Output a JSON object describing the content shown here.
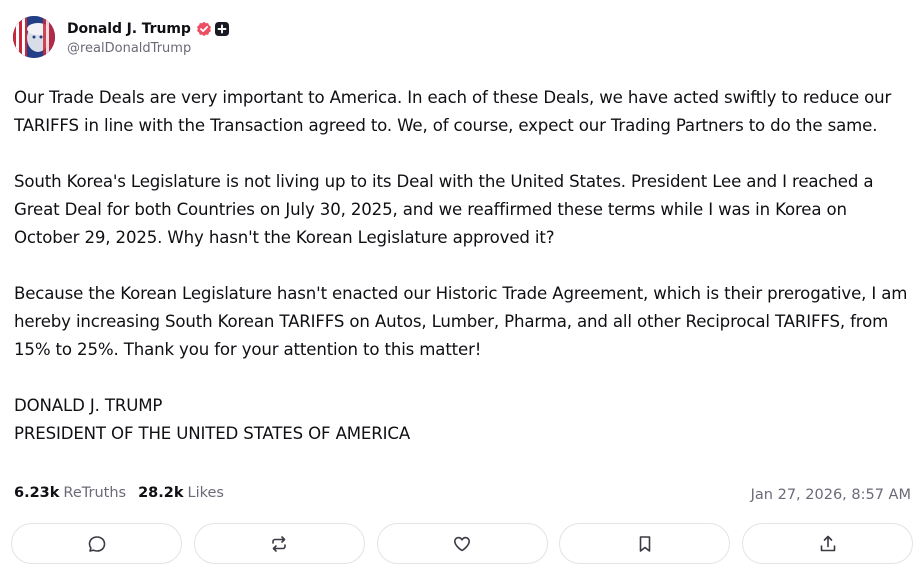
{
  "author": {
    "display_name": "Donald J. Trump",
    "handle": "@realDonaldTrump"
  },
  "post": {
    "paragraphs": [
      "Our Trade Deals are very important to America. In each of these Deals, we have acted swiftly to reduce our TARIFFS in line with the Transaction agreed to. We, of course, expect our Trading Partners to do the same.",
      "South Korea's Legislature is not living up to its Deal with the United States. President Lee and I reached a Great Deal for both Countries on July 30, 2025, and we reaffirmed these terms while I was in Korea on October 29, 2025. Why hasn't the Korean Legislature approved it?",
      "Because the Korean Legislature hasn't enacted our Historic Trade Agreement, which is their prerogative, I am hereby increasing South Korean TARIFFS on Autos, Lumber, Pharma, and all other Reciprocal TARIFFS, from 15% to 25%. Thank you for your attention to this matter!"
    ],
    "signature_line1": "DONALD J. TRUMP",
    "signature_line2": "PRESIDENT OF THE UNITED STATES OF AMERICA"
  },
  "stats": {
    "retruths_count": "6.23k",
    "retruths_label": "ReTruths",
    "likes_count": "28.2k",
    "likes_label": "Likes",
    "timestamp": "Jan 27, 2026, 8:57 AM"
  },
  "actions": [
    {
      "icon": "reply-icon"
    },
    {
      "icon": "retruth-icon"
    },
    {
      "icon": "like-icon"
    },
    {
      "icon": "bookmark-icon"
    },
    {
      "icon": "share-icon"
    }
  ],
  "colors": {
    "verified_badge": "#ec4e63",
    "text_primary": "#0f0f14",
    "text_secondary": "#6b6b78",
    "button_border": "#e3e3e8"
  }
}
